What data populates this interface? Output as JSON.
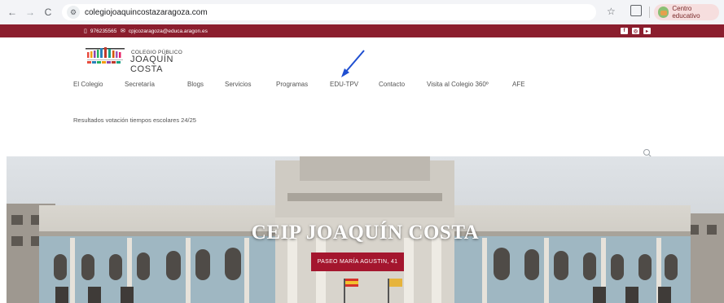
{
  "browser": {
    "url": "colegiojoaquincostazaragoza.com",
    "profile_label": "Centro educativo",
    "back_icon": "←",
    "forward_icon": "→",
    "reload_icon": "C",
    "star_icon": "☆"
  },
  "topbar": {
    "phone": "976235565",
    "email": "cpjcozaragoza@educa.aragon.es",
    "background": "#8b1e2e"
  },
  "logo": {
    "small": "COLEGIO PÚBLICO",
    "big": "JOAQUÍN COSTA"
  },
  "nav": {
    "items": [
      "El Colegio",
      "Secretaría",
      "Blogs",
      "Servicios",
      "Programas",
      "EDU-TPV",
      "Contacto",
      "Visita al Colegio 360º",
      "AFE"
    ]
  },
  "subnav": {
    "link": "Resultados votación tiempos escolares 24/25"
  },
  "hero": {
    "title": "CEIP JOAQUÍN COSTA",
    "button": "PASEO MARÍA AGUSTIN, 41",
    "button_color": "#a4162e"
  },
  "annotation": {
    "arrow_color": "#1f4fd1"
  }
}
